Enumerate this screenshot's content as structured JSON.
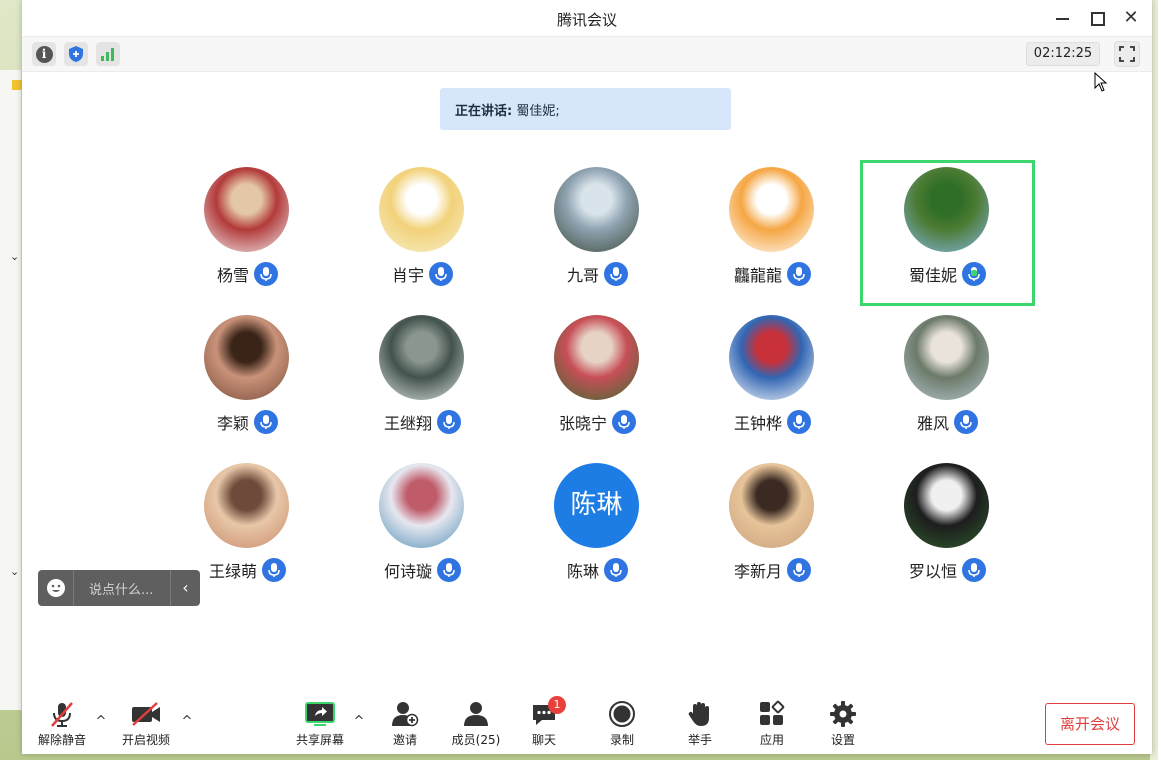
{
  "window": {
    "title": "腾讯会议",
    "close_glyph": "✕"
  },
  "infobar": {
    "timer": "02:12:25",
    "info_glyph": "i"
  },
  "speaking": {
    "label": "正在讲话:",
    "names": "蜀佳妮;"
  },
  "participants": [
    {
      "name": "杨雪",
      "avatar_colors": [
        "#f1f1f1",
        "#b33a3a",
        "#e4c6a8"
      ]
    },
    {
      "name": "肖宇",
      "avatar_colors": [
        "#f7eec9",
        "#f2d27a",
        "#ffffff"
      ]
    },
    {
      "name": "九哥",
      "avatar_colors": [
        "#3b4a3a",
        "#8fa3b1",
        "#d9e4ea"
      ]
    },
    {
      "name": "龘龍龍",
      "avatar_colors": [
        "#ffffff",
        "#f5a643",
        "#ffffff"
      ]
    },
    {
      "name": "蜀佳妮",
      "active": true,
      "avatar_colors": [
        "#87b7e6",
        "#4c7b33",
        "#2f6e26"
      ]
    },
    {
      "name": "李颖",
      "avatar_colors": [
        "#7a4d3a",
        "#c9927a",
        "#3a2418"
      ]
    },
    {
      "name": "王继翔",
      "avatar_colors": [
        "#dfe6e3",
        "#43524d",
        "#8a968f"
      ]
    },
    {
      "name": "张晓宁",
      "avatar_colors": [
        "#3b6b2f",
        "#c74f57",
        "#e6d3c6"
      ]
    },
    {
      "name": "王钟桦",
      "avatar_colors": [
        "#ffffff",
        "#3266b3",
        "#c9313a"
      ]
    },
    {
      "name": "雅风",
      "avatar_colors": [
        "#b7c7cf",
        "#6c7a6a",
        "#e9e3d9"
      ]
    },
    {
      "name": "王绿萌",
      "avatar_colors": [
        "#c98a6a",
        "#e7c7a8",
        "#6e4a3a"
      ]
    },
    {
      "name": "何诗璇",
      "avatar_colors": [
        "#4f8fb7",
        "#e7e7ef",
        "#c05c6a"
      ]
    },
    {
      "name": "陈琳",
      "avatar_text": "陈琳",
      "avatar_colors": [
        "#1e7de4"
      ]
    },
    {
      "name": "李新月",
      "avatar_colors": [
        "#c9a07a",
        "#e7c49a",
        "#3a2a22"
      ]
    },
    {
      "name": "罗以恒",
      "avatar_colors": [
        "#2f5e2f",
        "#1d1d1d",
        "#f0f0f0"
      ]
    }
  ],
  "chat": {
    "placeholder": "说点什么..."
  },
  "toolbar": {
    "unmute": "解除静音",
    "start_video": "开启视频",
    "share_screen": "共享屏幕",
    "invite": "邀请",
    "members": "成员(25)",
    "chat": "聊天",
    "chat_badge": "1",
    "record": "录制",
    "raise_hand": "举手",
    "apps": "应用",
    "settings": "设置",
    "leave": "离开会议",
    "caret": "^"
  },
  "colors": {
    "accent_blue": "#2f74e0",
    "active_border": "#3dd56d",
    "speaking_bg": "#d6e7fb",
    "leave_red": "#e03f3f",
    "badge_red": "#e8413c"
  }
}
